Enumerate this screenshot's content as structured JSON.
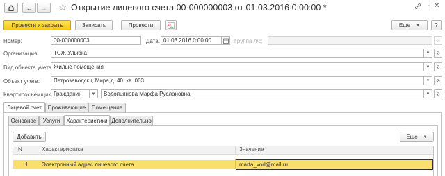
{
  "window": {
    "title": "Открытие лицевого счета 00-000000003 от 01.03.2016 0:00:00 *",
    "icons": [
      "link-icon",
      "more-icon",
      "close-icon"
    ]
  },
  "nav": {
    "back": "←",
    "forward": "→",
    "star": "☆"
  },
  "toolbar": {
    "post_and_close": "Провести и закрыть",
    "save": "Записать",
    "post": "Провести",
    "more": "Еще",
    "help": "?"
  },
  "form": {
    "number_label": "Номер:",
    "number_value": "00-000000003",
    "date_label": "Дата:",
    "date_value": "01.03.2016  0:00:00",
    "group_label": "Группа л/с:",
    "group_value": "",
    "org_label": "Организация:",
    "org_value": "ТСЖ Улыбка",
    "type_label": "Вид объекта учета:",
    "type_value": "Жилые помещения",
    "object_label": "Объект учета:",
    "object_value": "Петрозаводск г, Мира,д. 40, кв. 003",
    "tenant_label": "Квартиросъемщик:",
    "tenant_kind": "Гражданин",
    "tenant_name": "Водопьянова Марфа Руслановна"
  },
  "tabs_main": [
    "Лицевой счет",
    "Проживающие",
    "Помещение"
  ],
  "tabs_sub": [
    "Основное",
    "Услуги",
    "Характеристики",
    "Дополнительно"
  ],
  "sub_toolbar": {
    "add": "Добавить",
    "more": "Еще"
  },
  "table": {
    "columns": [
      "N",
      "Характеристика",
      "Значение"
    ],
    "rows": [
      {
        "n": "1",
        "name": "Электронный адрес лицевого счета",
        "value": "marfa_vod@mail.ru"
      }
    ]
  },
  "colors": {
    "primary": "#f4c616",
    "selected_row": "#f9df6e"
  }
}
